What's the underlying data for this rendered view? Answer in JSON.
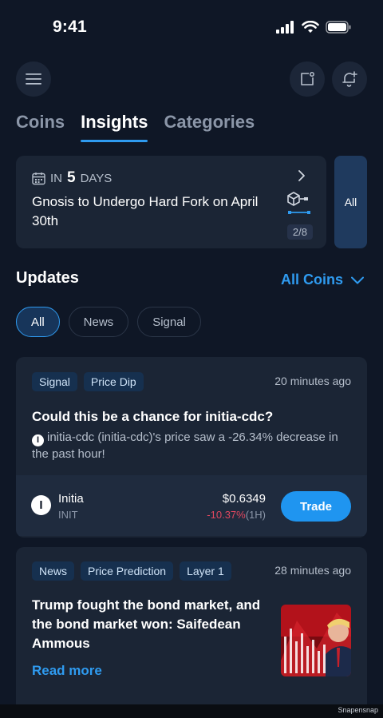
{
  "status_bar": {
    "time": "9:41"
  },
  "header": {
    "menu_icon": "hamburger-icon",
    "note_icon": "note-add-icon",
    "alert_icon": "bell-add-icon"
  },
  "tabs": [
    {
      "label": "Coins",
      "active": false
    },
    {
      "label": "Insights",
      "active": true
    },
    {
      "label": "Categories",
      "active": false
    }
  ],
  "event": {
    "prefix": "IN",
    "days": "5",
    "suffix": "DAYS",
    "title": "Gnosis to Undergo Hard Fork on April 30th",
    "page": "2/8",
    "side_label": "All"
  },
  "updates": {
    "title": "Updates",
    "filter": "All Coins",
    "chips": [
      {
        "label": "All",
        "active": true
      },
      {
        "label": "News",
        "active": false
      },
      {
        "label": "Signal",
        "active": false
      }
    ]
  },
  "cards": [
    {
      "tags": [
        "Signal",
        "Price Dip"
      ],
      "time": "20 minutes ago",
      "title": "Could this be a chance for initia-cdc?",
      "body": "initia-cdc (initia-cdc)'s price saw a -26.34% decrease in the past hour!",
      "coin": {
        "name": "Initia",
        "symbol": "INIT",
        "price": "$0.6349",
        "change": "-10.37%",
        "period": "(1H)"
      },
      "trade_label": "Trade"
    },
    {
      "tags": [
        "News",
        "Price Prediction",
        "Layer 1"
      ],
      "time": "28 minutes ago",
      "title": "Trump fought the bond market, and the bond market won: Saifedean Ammous",
      "read_more": "Read more"
    }
  ],
  "watermark": "Snapensnap",
  "colors": {
    "accent": "#2f9bf0",
    "negative": "#e0475f",
    "background": "#0f1726",
    "card": "#1b2535"
  }
}
